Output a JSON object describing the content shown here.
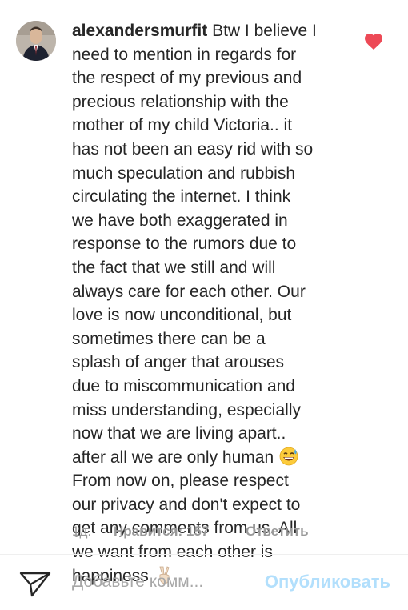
{
  "comment": {
    "username": "alexandersmurfit",
    "lines": [
      "Btw I believe I",
      "need to mention in regards for",
      "the respect of my previous and",
      "precious relationship with the",
      "mother of my child Victoria.. it",
      "has not been an easy rid with so",
      "much speculation and rubbish",
      "circulating the internet. I think",
      "we have both exaggerated in",
      "response to the rumors due to",
      "the fact that we still and will",
      "always care for each other. Our",
      "love is now unconditional, but",
      "sometimes there can be a",
      "splash of anger that arouses",
      "due to miscommunication and",
      "miss understanding, especially",
      "now that we are living apart..",
      "after all we are only human",
      "From now on, please respect",
      "our privacy and don't expect to",
      "get any comments from us. All",
      "we want from each other is",
      "happiness"
    ],
    "emoji_1": "sweat-smile-emoji",
    "emoji_2": "victory-hand-emoji",
    "liked": true,
    "heart_color": "#ed4956"
  },
  "meta": {
    "time": "1д.",
    "likes": "Нравится: 157",
    "reply": "Ответить"
  },
  "composer": {
    "placeholder": "Добавьте комм...",
    "publish_label": "Опубликовать",
    "publish_color": "#b2dffc"
  }
}
